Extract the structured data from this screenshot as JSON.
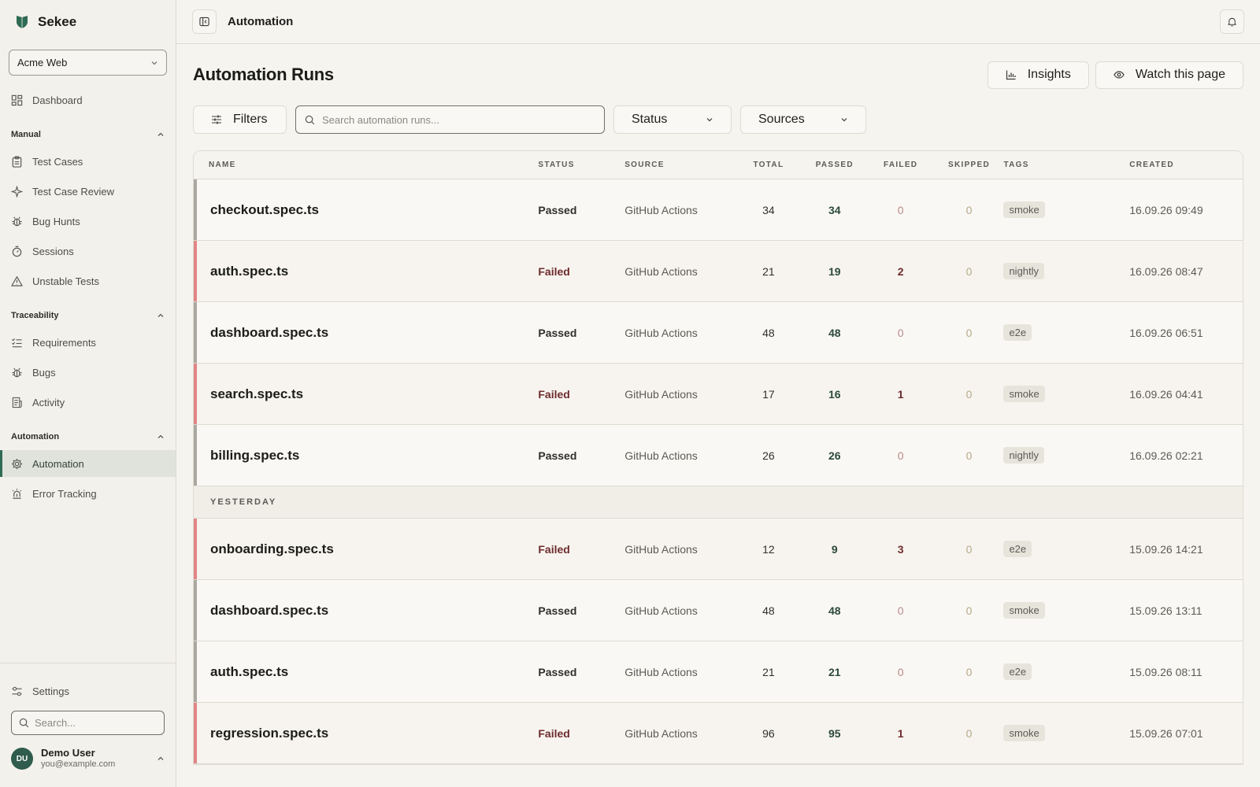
{
  "app": {
    "name": "Sekee",
    "brand_color": "#2f6a54"
  },
  "project": {
    "selected": "Acme Web"
  },
  "sidebar": {
    "dashboard": "Dashboard",
    "sections": [
      {
        "title": "Manual",
        "items": [
          "Test Cases",
          "Test Case Review",
          "Bug Hunts",
          "Sessions",
          "Unstable Tests"
        ]
      },
      {
        "title": "Traceability",
        "items": [
          "Requirements",
          "Bugs",
          "Activity"
        ]
      },
      {
        "title": "Automation",
        "items": [
          "Automation",
          "Error Tracking"
        ]
      }
    ],
    "active_item": "Automation",
    "settings": "Settings",
    "search_placeholder": "Search..."
  },
  "user": {
    "initials": "DU",
    "name": "Demo User",
    "email": "you@example.com"
  },
  "topbar": {
    "title": "Automation"
  },
  "page": {
    "title": "Automation Runs",
    "insights_label": "Insights",
    "watch_label": "Watch this page"
  },
  "toolbar": {
    "filters_label": "Filters",
    "search_placeholder": "Search automation runs...",
    "status_label": "Status",
    "sources_label": "Sources"
  },
  "table": {
    "columns": [
      "NAME",
      "STATUS",
      "SOURCE",
      "TOTAL",
      "PASSED",
      "FAILED",
      "SKIPPED",
      "TAGS",
      "CREATED"
    ],
    "today_rows": [
      {
        "name": "checkout.spec.ts",
        "status": "Passed",
        "source": "GitHub Actions",
        "total": "34",
        "passed": "34",
        "failed": "0",
        "skipped": "0",
        "tag": "smoke",
        "created": "16.09.26 09:49"
      },
      {
        "name": "auth.spec.ts",
        "status": "Failed",
        "source": "GitHub Actions",
        "total": "21",
        "passed": "19",
        "failed": "2",
        "skipped": "0",
        "tag": "nightly",
        "created": "16.09.26 08:47"
      },
      {
        "name": "dashboard.spec.ts",
        "status": "Passed",
        "source": "GitHub Actions",
        "total": "48",
        "passed": "48",
        "failed": "0",
        "skipped": "0",
        "tag": "e2e",
        "created": "16.09.26 06:51"
      },
      {
        "name": "search.spec.ts",
        "status": "Failed",
        "source": "GitHub Actions",
        "total": "17",
        "passed": "16",
        "failed": "1",
        "skipped": "0",
        "tag": "smoke",
        "created": "16.09.26 04:41"
      },
      {
        "name": "billing.spec.ts",
        "status": "Passed",
        "source": "GitHub Actions",
        "total": "26",
        "passed": "26",
        "failed": "0",
        "skipped": "0",
        "tag": "nightly",
        "created": "16.09.26 02:21"
      }
    ],
    "group_label": "YESTERDAY",
    "yesterday_rows": [
      {
        "name": "onboarding.spec.ts",
        "status": "Failed",
        "source": "GitHub Actions",
        "total": "12",
        "passed": "9",
        "failed": "3",
        "skipped": "0",
        "tag": "e2e",
        "created": "15.09.26 14:21"
      },
      {
        "name": "dashboard.spec.ts",
        "status": "Passed",
        "source": "GitHub Actions",
        "total": "48",
        "passed": "48",
        "failed": "0",
        "skipped": "0",
        "tag": "smoke",
        "created": "15.09.26 13:11"
      },
      {
        "name": "auth.spec.ts",
        "status": "Passed",
        "source": "GitHub Actions",
        "total": "21",
        "passed": "21",
        "failed": "0",
        "skipped": "0",
        "tag": "e2e",
        "created": "15.09.26 08:11"
      },
      {
        "name": "regression.spec.ts",
        "status": "Failed",
        "source": "GitHub Actions",
        "total": "96",
        "passed": "95",
        "failed": "1",
        "skipped": "0",
        "tag": "smoke",
        "created": "15.09.26 07:01"
      }
    ]
  }
}
